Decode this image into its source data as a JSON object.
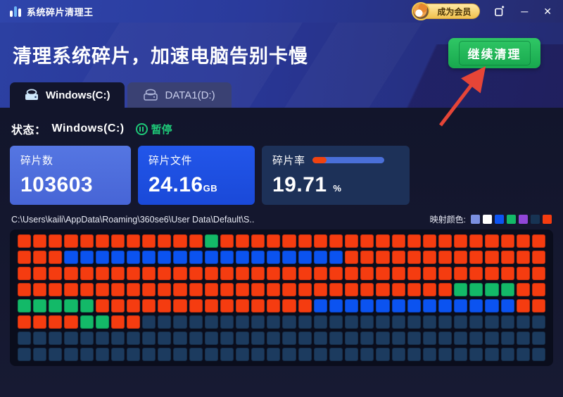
{
  "window": {
    "title": "系统碎片清理王",
    "member_label": "成为会员",
    "minimize_glyph": "─",
    "close_glyph": "✕"
  },
  "banner": {
    "headline": "清理系统碎片，加速电脑告别卡慢",
    "action_label": "继续清理"
  },
  "tabs": [
    {
      "label": "Windows(C:)",
      "active": true
    },
    {
      "label": "DATA1(D:)",
      "active": false
    }
  ],
  "status": {
    "label": "状态：",
    "drive": "Windows(C:)",
    "pause_label": "暂停"
  },
  "stats": {
    "fragments": {
      "label": "碎片数",
      "value": "103603"
    },
    "size": {
      "label": "碎片文件",
      "value": "24.16",
      "unit": "GB"
    },
    "rate": {
      "label": "碎片率",
      "value": "19.71",
      "unit": "%",
      "progress_percent": 19.71
    }
  },
  "map": {
    "path": "C:\\Users\\kaili\\AppData\\Roaming\\360se6\\User Data\\Default\\S..",
    "legend_label": "映射颜色:",
    "legend_colors": [
      "#7b90e0",
      "#ffffff",
      "#0d54f2",
      "#13b968",
      "#9046d8",
      "#173353",
      "#f53c10"
    ],
    "cell_colors": {
      "O": "#f53c10",
      "B": "#0b53f0",
      "G": "#13b968",
      "N": "#1c3b5f"
    },
    "rows": [
      "OOOOOOOOOOOOGOOOOOOOOOOOOOOOOOOOOO",
      "OOOBBBBBBBBBBBBBBBBBBOOOOOOOOOOOOO",
      "OOOOOOOOOOOOOOOOOOOOOOOOOOOOOOOOOO",
      "OOOOOOOOOOOOOOOOOOOOOOOOOOOOGGGGOO",
      "GGGGGOOOOOOOOOOOOOOBBBBBBBBBBBBBOO",
      "OOOOGGOONNNNNNNNNNNNNNNNNNNNNNNNNN",
      "NNNNNNNNNNNNNNNNNNNNNNNNNNNNNNNNNN",
      "NNNNNNNNNNNNNNNNNNNNNNNNNNNNNNNNNN"
    ]
  },
  "colors": {
    "accent_green": "#1ec878",
    "button_green": "#1fb357",
    "gold": "#f0c14e",
    "arrow_red": "#e64537"
  }
}
